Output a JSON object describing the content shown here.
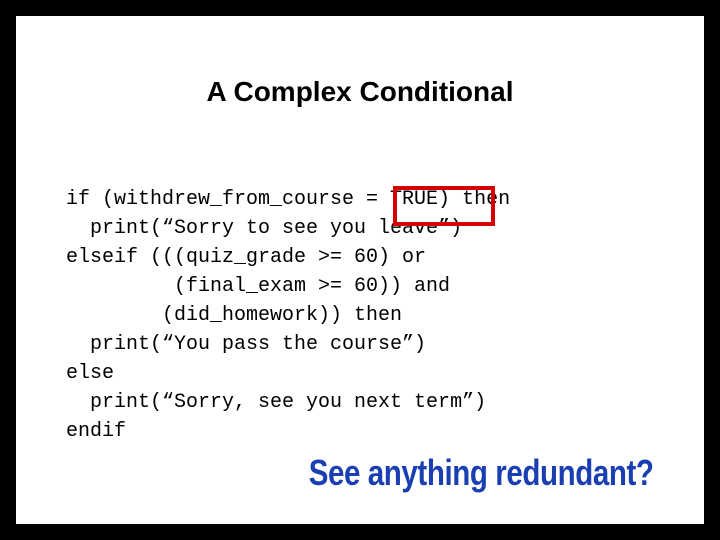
{
  "title": "A Complex Conditional",
  "code": {
    "l1": "if (withdrew_from_course = TRUE) then",
    "l2": "  print(“Sorry to see you leave”)",
    "l3": "elseif (((quiz_grade >= 60) or",
    "l4": "         (final_exam >= 60)) and",
    "l5": "        (did_homework)) then",
    "l6": "  print(“You pass the course”)",
    "l7": "else",
    "l8": "  print(“Sorry, see you next term”)",
    "l9": "endif"
  },
  "callout": "See anything redundant?"
}
